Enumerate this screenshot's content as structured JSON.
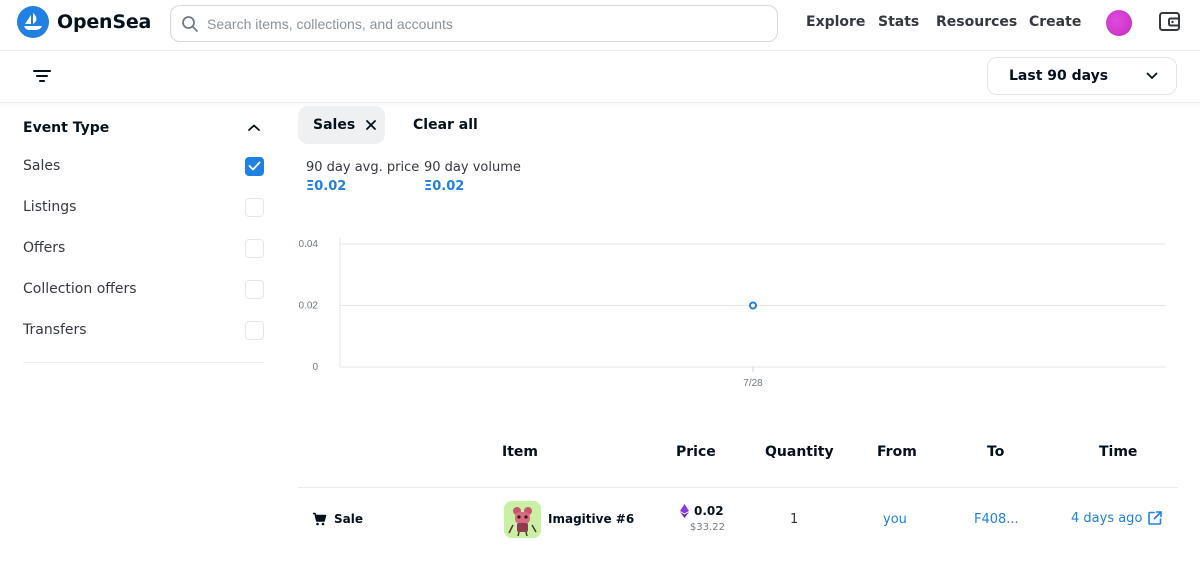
{
  "header": {
    "brand": "OpenSea",
    "search_placeholder": "Search items, collections, and accounts",
    "nav": [
      "Explore",
      "Stats",
      "Resources",
      "Create"
    ]
  },
  "toolbar": {
    "range_label": "Last 90 days"
  },
  "sidebar": {
    "title": "Event Type",
    "items": [
      {
        "label": "Sales",
        "checked": true
      },
      {
        "label": "Listings",
        "checked": false
      },
      {
        "label": "Offers",
        "checked": false
      },
      {
        "label": "Collection offers",
        "checked": false
      },
      {
        "label": "Transfers",
        "checked": false
      }
    ]
  },
  "filters": {
    "active_chip": "Sales",
    "clear_label": "Clear all"
  },
  "stats": {
    "avg_label": "90 day avg. price",
    "avg_value": "Ξ0.02",
    "volume_label": "90 day volume",
    "volume_value": "Ξ0.02"
  },
  "chart_data": {
    "type": "scatter",
    "x": [
      "7/28"
    ],
    "y": [
      0.02
    ],
    "yticks": [
      "0.04",
      "0.02",
      "0"
    ],
    "xticks": [
      "7/28"
    ],
    "ylim": [
      0,
      0.04
    ],
    "grid": true,
    "point_color": "#2081e2"
  },
  "table": {
    "columns": [
      "Item",
      "Price",
      "Quantity",
      "From",
      "To",
      "Time"
    ],
    "rows": [
      {
        "event": "Sale",
        "item": "Imagitive #6",
        "price": "0.02",
        "price_usd": "$33.22",
        "quantity": "1",
        "from": "you",
        "to": "F408...",
        "time": "4 days ago"
      }
    ]
  },
  "colors": {
    "accent": "#2081e2",
    "text": "#04111d"
  }
}
